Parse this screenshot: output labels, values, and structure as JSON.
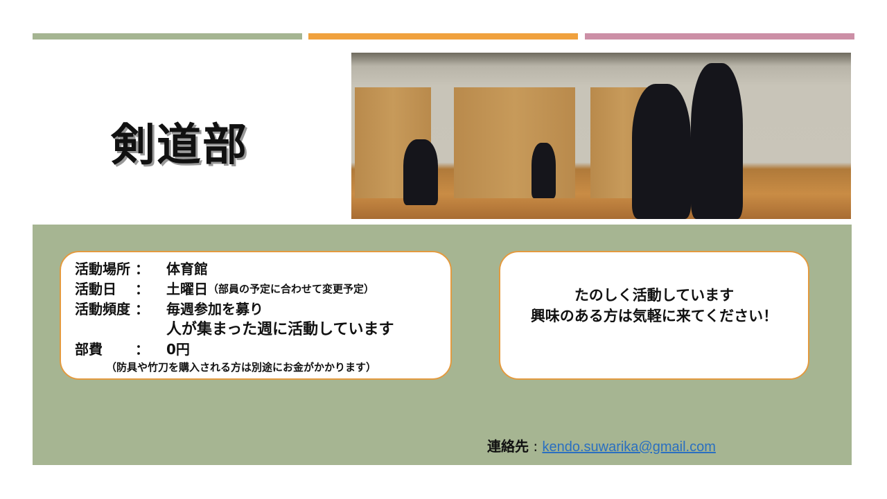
{
  "title": "剣道部",
  "info": {
    "place_label": "活動場所 ：",
    "place": "体育館",
    "day_label": "活動日　 ：",
    "day": "土曜日",
    "day_note": "（部員の予定に合わせて変更予定）",
    "freq_label": "活動頻度 ：",
    "freq_line1": "毎週参加を募り",
    "freq_line2": "人が集まった週に活動しています",
    "fee_label": "部費　　 ：",
    "fee": "0円",
    "fee_note": "（防具や竹刀を購入される方は別途にお金がかかります）"
  },
  "message": {
    "line1": "たのしく活動しています",
    "line2": "興味のある方は気軽に来てください！"
  },
  "contact": {
    "label": "連絡先",
    "sep": " : ",
    "email": "kendo.suwarika@gmail.com"
  },
  "colors": {
    "bar1": "#a5b592",
    "bar2": "#f0a13e",
    "bar3": "#cc8fa6",
    "panel": "#a6b592",
    "border": "#e39a3f",
    "link": "#2a6fc0"
  }
}
